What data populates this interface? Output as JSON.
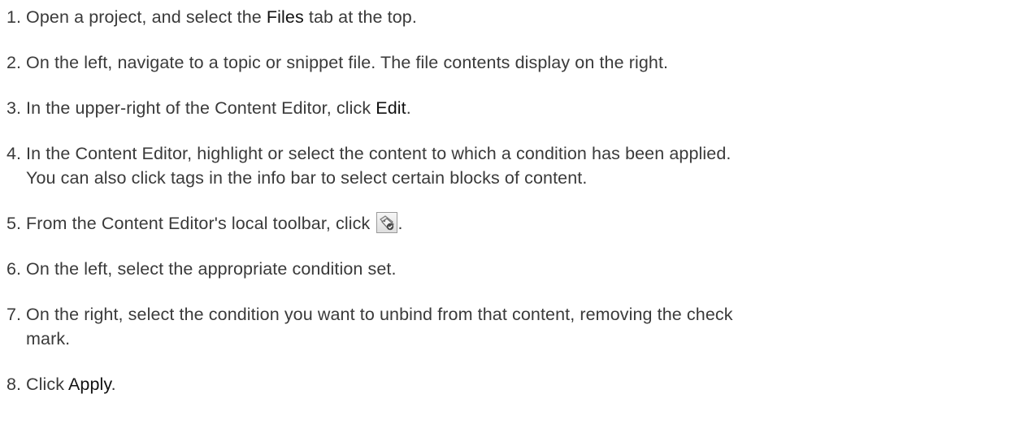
{
  "steps": [
    {
      "number": "1.",
      "before": "Open a project, and select the ",
      "bold": "Files",
      "after": " tab at the top."
    },
    {
      "number": "2.",
      "text": "On the left, navigate to a topic or snippet file. The file contents display on the right."
    },
    {
      "number": "3.",
      "before": "In the upper-right of the Content Editor, click ",
      "bold": "Edit",
      "after": "."
    },
    {
      "number": "4.",
      "line1": "In the Content Editor, highlight or select the content to which a condition has been applied.",
      "line2": "You can also click tags in the info bar to select certain blocks of content."
    },
    {
      "number": "5.",
      "before": "From the Content Editor's local toolbar, click ",
      "icon": "condition-tag-icon",
      "after": "."
    },
    {
      "number": "6.",
      "text": "On the left, select the appropriate condition set."
    },
    {
      "number": "7.",
      "line1": "On the right, select the condition you want to unbind from that content, removing the check",
      "line2": "mark."
    },
    {
      "number": "8.",
      "before": "Click ",
      "bold": "Apply",
      "after": "."
    }
  ]
}
